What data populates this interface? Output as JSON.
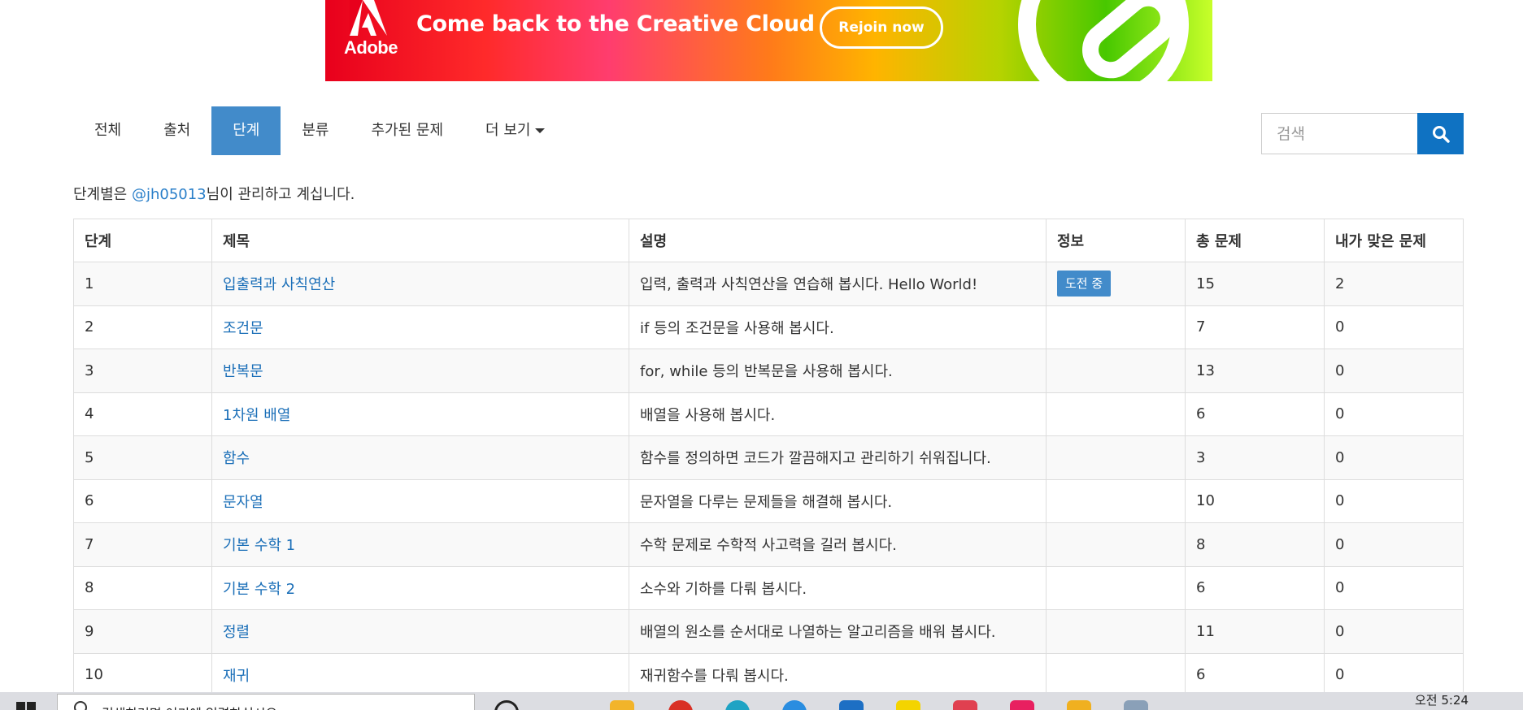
{
  "ad": {
    "logo_text": "Adobe",
    "headline": "Come back to the Creative Cloud",
    "button_label": "Rejoin now"
  },
  "nav": {
    "items": [
      {
        "label": "전체"
      },
      {
        "label": "출처"
      },
      {
        "label": "단계",
        "active": true
      },
      {
        "label": "분류"
      },
      {
        "label": "추가된 문제"
      },
      {
        "label": "더 보기"
      }
    ]
  },
  "search": {
    "placeholder": "검색"
  },
  "manage": {
    "prefix": "단계별은 ",
    "user": "@jh05013",
    "suffix": "님이 관리하고 계십니다."
  },
  "table": {
    "headers": [
      "단계",
      "제목",
      "설명",
      "정보",
      "총 문제",
      "내가 맞은 문제"
    ],
    "rows": [
      {
        "step": "1",
        "title": "입출력과 사칙연산",
        "desc": "입력, 출력과 사칙연산을 연습해 봅시다. Hello World!",
        "info": "도전 중",
        "total": "15",
        "solved": "2"
      },
      {
        "step": "2",
        "title": "조건문",
        "desc": "if 등의 조건문을 사용해 봅시다.",
        "info": "",
        "total": "7",
        "solved": "0"
      },
      {
        "step": "3",
        "title": "반복문",
        "desc": "for, while 등의 반복문을 사용해 봅시다.",
        "info": "",
        "total": "13",
        "solved": "0"
      },
      {
        "step": "4",
        "title": "1차원 배열",
        "desc": "배열을 사용해 봅시다.",
        "info": "",
        "total": "6",
        "solved": "0"
      },
      {
        "step": "5",
        "title": "함수",
        "desc": "함수를 정의하면 코드가 깔끔해지고 관리하기 쉬워집니다.",
        "info": "",
        "total": "3",
        "solved": "0"
      },
      {
        "step": "6",
        "title": "문자열",
        "desc": "문자열을 다루는 문제들을 해결해 봅시다.",
        "info": "",
        "total": "10",
        "solved": "0"
      },
      {
        "step": "7",
        "title": "기본 수학 1",
        "desc": "수학 문제로 수학적 사고력을 길러 봅시다.",
        "info": "",
        "total": "8",
        "solved": "0"
      },
      {
        "step": "8",
        "title": "기본 수학 2",
        "desc": "소수와 기하를 다뤄 봅시다.",
        "info": "",
        "total": "6",
        "solved": "0"
      },
      {
        "step": "9",
        "title": "정렬",
        "desc": "배열의 원소를 순서대로 나열하는 알고리즘을 배워 봅시다.",
        "info": "",
        "total": "11",
        "solved": "0"
      },
      {
        "step": "10",
        "title": "재귀",
        "desc": "재귀함수를 다뤄 봅시다.",
        "info": "",
        "total": "6",
        "solved": "0"
      }
    ]
  },
  "taskbar": {
    "search_text": "검색하려면 여기에 입력하십시오.",
    "clock": "오전 5:24"
  },
  "colors": {
    "accent": "#428bca",
    "link": "#1b6fb8",
    "search_button": "#0f72c2"
  }
}
